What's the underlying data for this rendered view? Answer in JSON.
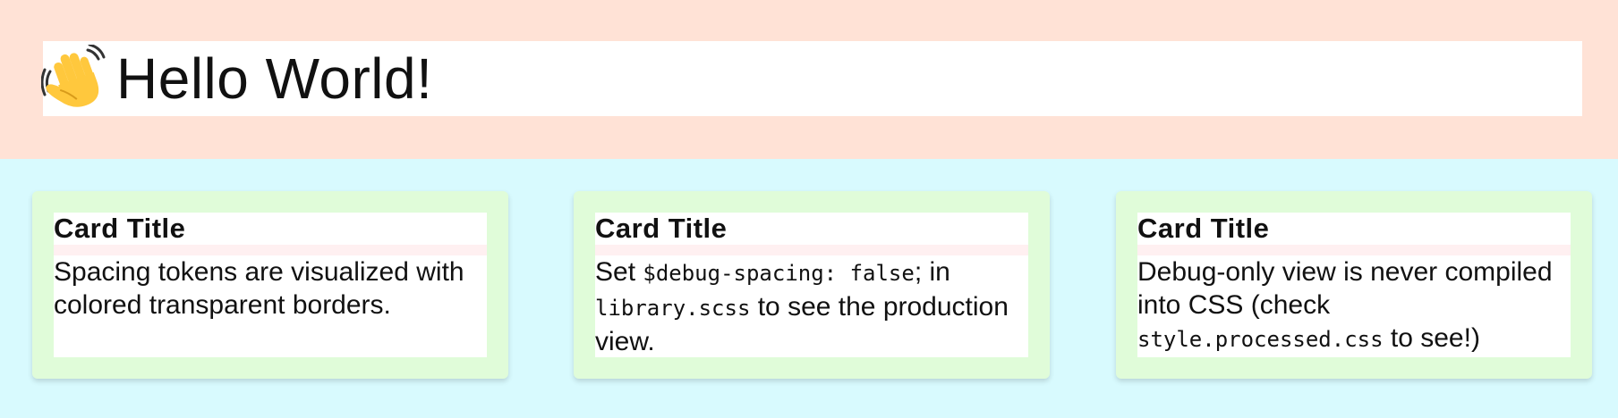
{
  "header": {
    "emoji": "👋",
    "title": "Hello World!"
  },
  "colors": {
    "header_bg": "#ffe2d6",
    "main_bg": "#d8fafe",
    "card_bg": "#e0fcd9",
    "card_gap": "#fff0f1",
    "wave_hand": "#ffc83d"
  },
  "cards": [
    {
      "title": "Card Title",
      "body": [
        {
          "text": "Spacing tokens are visualized with colored transparent borders."
        }
      ]
    },
    {
      "title": "Card Title",
      "body": [
        {
          "text": "Set "
        },
        {
          "code": "$debug-spacing: false"
        },
        {
          "text": "; in "
        },
        {
          "code": "library.scss"
        },
        {
          "text": " to see the production view."
        }
      ]
    },
    {
      "title": "Card Title",
      "body": [
        {
          "text": "Debug-only view is never compiled into CSS (check "
        },
        {
          "code": "style.processed.css"
        },
        {
          "text": " to see!)"
        }
      ]
    }
  ]
}
